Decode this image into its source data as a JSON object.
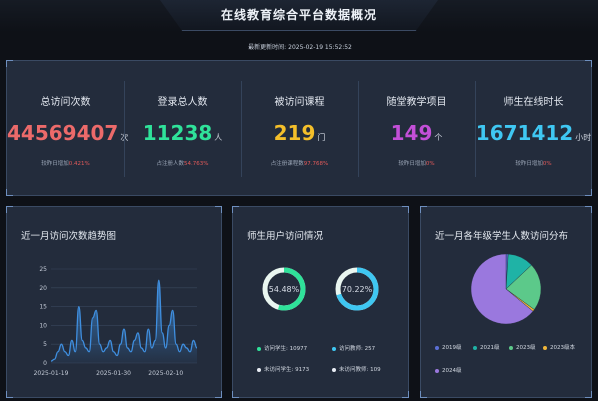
{
  "header": {
    "title": "在线教育综合平台数据概况"
  },
  "update": {
    "label": "最新更新时间:",
    "time": "2025-02-19 15:52:52"
  },
  "stats": [
    {
      "label": "总访问次数",
      "value": "44569407",
      "unit": "次",
      "sub_label": "较昨日增加",
      "sub_value": "0.421%",
      "color": "#ec6a6a"
    },
    {
      "label": "登录总人数",
      "value": "11238",
      "unit": "人",
      "sub_label": "占注册人数",
      "sub_value": "54.763%",
      "color": "#2fe29a"
    },
    {
      "label": "被访问课程",
      "value": "219",
      "unit": "门",
      "sub_label": "占注册课程数",
      "sub_value": "97.768%",
      "color": "#f4bf2a"
    },
    {
      "label": "随堂教学项目",
      "value": "149",
      "unit": "个",
      "sub_label": "较昨日增加",
      "sub_value": "0%",
      "color": "#c34fd8"
    },
    {
      "label": "师生在线时长",
      "value": "1671412",
      "unit": "小时",
      "sub_label": "较昨日增加",
      "sub_value": "0%",
      "color": "#3fc7f2"
    }
  ],
  "trend_panel": {
    "title": "近一月访问次数趋势图"
  },
  "users_panel": {
    "title": "师生用户访问情况",
    "rings": [
      {
        "label": "54.48%",
        "value": 54.48,
        "color": "#2fe29a"
      },
      {
        "label": "70.22%",
        "value": 70.22,
        "color": "#3fc7f2"
      }
    ],
    "legend": [
      {
        "label": "访问学生: 10977",
        "color": "#2fe29a"
      },
      {
        "label": "访问教师: 257",
        "color": "#3fc7f2"
      },
      {
        "label": "未访问学生: 9173",
        "color": "#e8edf4"
      },
      {
        "label": "未访问教师: 109",
        "color": "#e8edf4"
      }
    ]
  },
  "grades_panel": {
    "title": "近一月各年级学生人数访问分布",
    "legend": [
      {
        "label": "2019级",
        "color": "#5b6fd6"
      },
      {
        "label": "2021级",
        "color": "#1fb3a6"
      },
      {
        "label": "2023级",
        "color": "#5cc98a"
      },
      {
        "label": "2023级本",
        "color": "#f0b63a"
      },
      {
        "label": "2024级",
        "color": "#9a78de"
      }
    ]
  },
  "chart_data": [
    {
      "type": "area",
      "title": "近一月访问次数趋势图",
      "x_ticks": [
        "2025-01-19",
        "2025-01-30",
        "2025-02-10"
      ],
      "y_ticks": [
        0,
        5,
        10,
        15,
        20,
        25
      ],
      "ylim": [
        0,
        25
      ],
      "grid": true,
      "color": "#3f8fe0",
      "values": [
        0.5,
        1,
        3,
        5,
        3,
        2,
        6,
        3,
        15,
        6,
        4,
        3,
        12,
        14,
        5,
        3,
        4,
        6,
        3,
        2,
        5,
        9,
        4,
        3,
        6,
        8,
        4,
        3,
        9,
        4,
        6,
        22,
        8,
        4,
        10,
        14,
        5,
        3,
        5,
        4,
        3,
        6,
        4
      ]
    },
    {
      "type": "pie",
      "title": "近一月各年级学生人数访问分布",
      "categories": [
        "2019级",
        "2021级",
        "2023级",
        "2023级本",
        "2024级"
      ],
      "values": [
        1,
        12,
        22,
        1,
        64
      ]
    }
  ]
}
